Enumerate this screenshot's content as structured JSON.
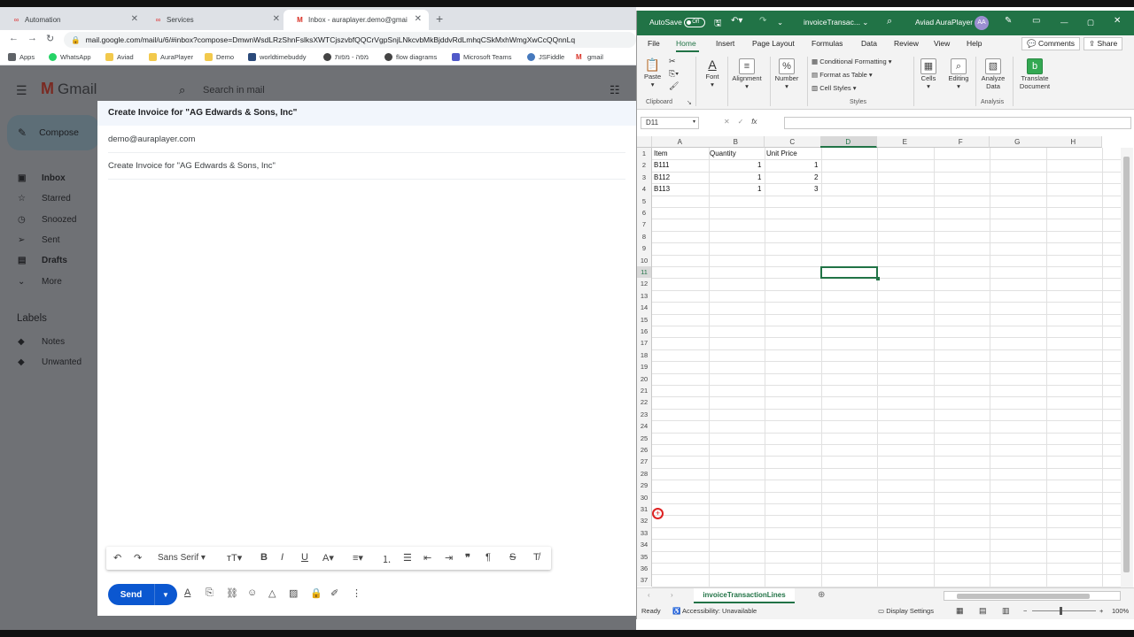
{
  "browser": {
    "tabs": [
      {
        "title": "Automation",
        "icon": "auraplayer-icon"
      },
      {
        "title": "Services",
        "icon": "auraplayer-icon"
      },
      {
        "title": "Inbox - auraplayer.demo@gmai",
        "icon": "gmail-icon"
      }
    ],
    "url": "mail.google.com/mail/u/6/#inbox?compose=DmwnWsdLRzShnFslksXWTCjszvbfQQCrVgpSnjLNkcvbMkBjddvRdLmhqCSkMxhWmgXwCcQQnnLq",
    "bookmarks": [
      "Apps",
      "WhatsApp",
      "Aviad",
      "AuraPlayer",
      "Demo",
      "worldtimebuddy",
      "מפה - מפות",
      "flow diagrams",
      "Microsoft Teams",
      "JSFiddle",
      "gmail"
    ]
  },
  "gmail": {
    "logo": "Gmail",
    "search_placeholder": "Search in mail",
    "compose_label": "Compose",
    "nav": [
      {
        "label": "Inbox",
        "icon": "inbox-icon",
        "bold": true
      },
      {
        "label": "Starred",
        "icon": "star-icon",
        "bold": false
      },
      {
        "label": "Snoozed",
        "icon": "clock-icon",
        "bold": false
      },
      {
        "label": "Sent",
        "icon": "send-icon",
        "bold": false
      },
      {
        "label": "Drafts",
        "icon": "file-icon",
        "bold": true
      },
      {
        "label": "More",
        "icon": "chevron-down-icon",
        "bold": false
      }
    ],
    "labels_title": "Labels",
    "labels": [
      "Notes",
      "Unwanted"
    ]
  },
  "compose": {
    "header": "Create Invoice for \"AG Edwards & Sons, Inc\"",
    "to": "demo@auraplayer.com",
    "subject": "Create Invoice for \"AG Edwards & Sons, Inc\"",
    "font": "Sans Serif",
    "send_label": "Send"
  },
  "excel": {
    "autosave": "AutoSave",
    "autosave_state": "Off",
    "filename": "invoiceTransac...",
    "user": "Aviad AuraPlayer",
    "user_initials": "AA",
    "menu": [
      "File",
      "Home",
      "Insert",
      "Page Layout",
      "Formulas",
      "Data",
      "Review",
      "View",
      "Help"
    ],
    "active_menu": "Home",
    "comments_label": "Comments",
    "share_label": "Share",
    "ribbon": {
      "paste": "Paste",
      "clipboard": "Clipboard",
      "font": "Font",
      "alignment": "Alignment",
      "number": "Number",
      "conditional_formatting": "Conditional Formatting",
      "format_as_table": "Format as Table",
      "cell_styles": "Cell Styles",
      "styles": "Styles",
      "cells": "Cells",
      "editing": "Editing",
      "analyze_data_1": "Analyze",
      "analyze_data_2": "Data",
      "analysis": "Analysis",
      "translate_1": "Translate",
      "translate_2": "Document"
    },
    "name_box": "D11",
    "columns": [
      "A",
      "B",
      "C",
      "D",
      "E",
      "F",
      "G",
      "H"
    ],
    "selected_column": "D",
    "selected_row": 11,
    "row_count": 37,
    "cells": {
      "header": [
        "Item",
        "Quantity",
        "Unit Price"
      ],
      "rows": [
        [
          "B111",
          "1",
          "1"
        ],
        [
          "B112",
          "1",
          "2"
        ],
        [
          "B113",
          "1",
          "3"
        ]
      ]
    },
    "sheet_name": "invoiceTransactionLines",
    "status_ready": "Ready",
    "accessibility": "Accessibility: Unavailable",
    "display_settings": "Display Settings",
    "zoom": "100%"
  }
}
